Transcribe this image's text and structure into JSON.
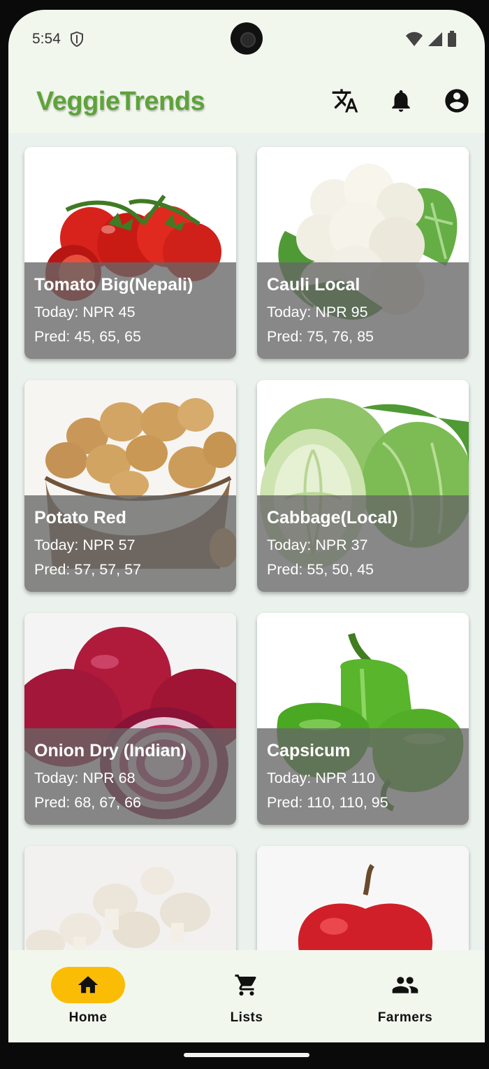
{
  "status": {
    "time": "5:54"
  },
  "app": {
    "title": "VeggieTrends",
    "actions": [
      {
        "icon": "translate-icon"
      },
      {
        "icon": "bell-icon"
      },
      {
        "icon": "account-icon"
      }
    ]
  },
  "products": [
    {
      "name": "Tomato Big(Nepali)",
      "today": "Today: NPR 45",
      "pred": "Pred: 45, 65, 65",
      "image": "tomato"
    },
    {
      "name": "Cauli Local",
      "today": "Today: NPR 95",
      "pred": "Pred: 75, 76, 85",
      "image": "cauliflower"
    },
    {
      "name": "Potato Red",
      "today": "Today: NPR 57",
      "pred": "Pred: 57, 57, 57",
      "image": "potato"
    },
    {
      "name": "Cabbage(Local)",
      "today": "Today: NPR 37",
      "pred": "Pred: 55, 50, 45",
      "image": "cabbage"
    },
    {
      "name": "Onion Dry (Indian)",
      "today": "Today: NPR 68",
      "pred": "Pred: 68, 67, 66",
      "image": "onion"
    },
    {
      "name": "Capsicum",
      "today": "Today: NPR 110",
      "pred": "Pred: 110, 110, 95",
      "image": "capsicum"
    }
  ],
  "nav": {
    "home": "Home",
    "lists": "Lists",
    "farmers": "Farmers",
    "active": "home"
  },
  "colors": {
    "brand": "#5ea33a",
    "nav_active": "#fbbc05",
    "overlay": "#666666"
  }
}
